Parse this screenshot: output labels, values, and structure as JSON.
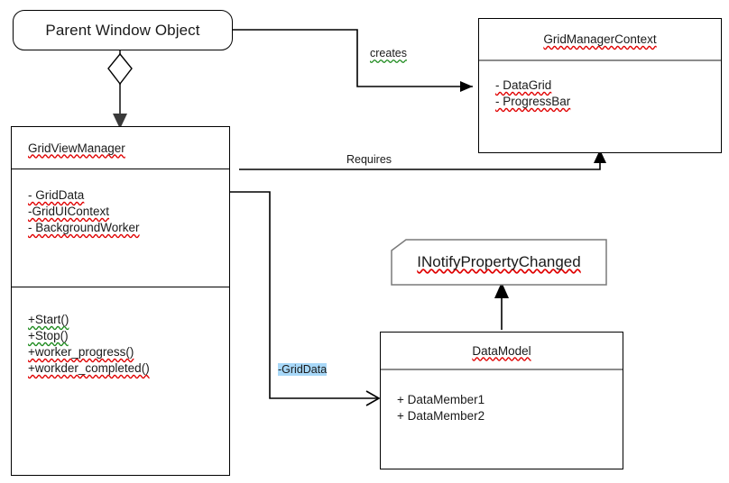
{
  "diagram": {
    "title": "GridViewManager UML class diagram",
    "type": "uml-class-diagram",
    "background": "#ffffff",
    "line_color": "#000000",
    "divider_color": "#8c8c8c",
    "text_color": "#1a1a1a",
    "spellcheck_red": "#e00000",
    "grammar_green": "#1d8a1d",
    "selection_highlight": "#a8d8f8"
  },
  "nodes": {
    "parent_window": {
      "label": "Parent Window Object",
      "shape": "rounded-rect"
    },
    "grid_manager_context": {
      "title": "GridManagerContext",
      "shape": "class-box",
      "attributes": [
        "- DataGrid",
        "- ProgressBar"
      ]
    },
    "grid_view_manager": {
      "title": "GridViewManager",
      "shape": "class-box",
      "attributes": [
        "- GridData",
        "-GridUIContext",
        "- BackgroundWorker"
      ],
      "methods": [
        "+Start()",
        "+Stop()",
        "+worker_progress()",
        "+workder_completed()"
      ]
    },
    "inotify_property_changed": {
      "label": "INotifyPropertyChanged",
      "shape": "note"
    },
    "data_model": {
      "title": "DataModel",
      "shape": "class-box",
      "attributes": [
        "+ DataMember1",
        "+ DataMember2"
      ]
    }
  },
  "edges": [
    {
      "name": "creates",
      "label": "creates",
      "from": "parent_window",
      "to": "grid_manager_context",
      "arrow": "filled-triangle"
    },
    {
      "name": "requires",
      "label": "Requires",
      "from": "grid_view_manager",
      "to": "grid_manager_context",
      "arrow": "filled-triangle"
    },
    {
      "name": "aggregation-parent-to-manager",
      "label": "",
      "from": "parent_window",
      "to": "grid_view_manager",
      "arrow": "diamond-and-arrow"
    },
    {
      "name": "grid-data-association",
      "label": "-GridData",
      "from": "grid_view_manager",
      "to": "data_model",
      "arrow": "open-arrow",
      "selected": true
    },
    {
      "name": "implements",
      "label": "",
      "from": "data_model",
      "to": "inotify_property_changed",
      "arrow": "filled-triangle-up"
    }
  ]
}
